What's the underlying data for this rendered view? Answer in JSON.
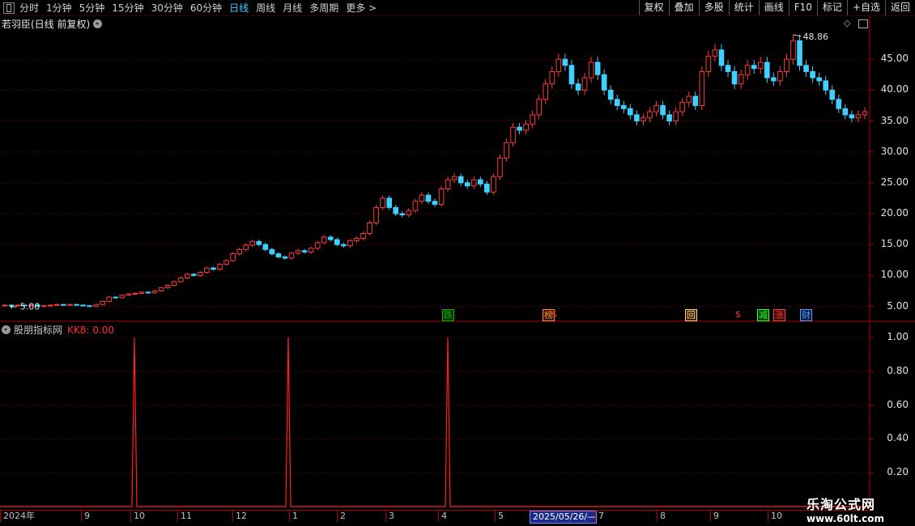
{
  "toolbar": {
    "periods": [
      "分时",
      "1分钟",
      "5分钟",
      "15分钟",
      "30分钟",
      "60分钟",
      "日线",
      "周线",
      "月线",
      "多周期",
      "更多 >"
    ],
    "active_period": "日线",
    "right_buttons": [
      "复权",
      "叠加",
      "多股",
      "统计",
      "画线",
      "F10",
      "标记",
      "+自选",
      "返回"
    ]
  },
  "main_chart": {
    "title": "若羽臣(日线 前复权)",
    "y_ticks": [
      "45.00",
      "40.00",
      "35.00",
      "30.00",
      "25.00",
      "20.00",
      "15.00",
      "10.00",
      "5.00"
    ],
    "high_label": "48.86",
    "low_label": "5.00",
    "tags": [
      {
        "text": "跌",
        "color": "#10b010",
        "bg": "#003300"
      },
      {
        "text": "榜",
        "color": "#ff8a3a",
        "bg": "#331a00"
      },
      {
        "text": "$",
        "color": "#ff3030",
        "bg": "transparent"
      },
      {
        "text": "回",
        "color": "#ffd080",
        "bg": "#332200"
      },
      {
        "text": "$",
        "color": "#ff3030",
        "bg": "transparent"
      },
      {
        "text": "减",
        "color": "#30ff30",
        "bg": "#004400"
      },
      {
        "text": "涨",
        "color": "#ff4040",
        "bg": "#330000"
      },
      {
        "text": "财",
        "color": "#60a0ff",
        "bg": "#001a44"
      }
    ]
  },
  "indicator": {
    "title": "股朋指标网",
    "series_label": "KK8: 0.00",
    "y_ticks": [
      "1.00",
      "0.80",
      "0.60",
      "0.40",
      "0.20"
    ]
  },
  "date_axis": [
    "2024年",
    "9",
    "10",
    "11",
    "12",
    "1",
    "2",
    "3",
    "4",
    "5",
    "2025/05/26/—",
    "7",
    "8",
    "9",
    "10"
  ],
  "watermark": {
    "line1": "乐淘公式网",
    "line2": "www.60lt.com"
  },
  "colors": {
    "up": "#ff3a3a",
    "down": "#3fd0ff",
    "grid": "#8a0000",
    "axis": "#b00000"
  },
  "chart_data": {
    "type": "candlestick",
    "title": "若羽臣(日线 前复权)",
    "ylim": [
      3.5,
      50
    ],
    "close_series": [
      5.2,
      5.1,
      5.2,
      5.1,
      5.2,
      5.0,
      5.1,
      5.2,
      5.3,
      5.2,
      5.3,
      5.2,
      5.1,
      5.0,
      5.3,
      5.8,
      6.5,
      6.4,
      6.8,
      7.0,
      7.1,
      7.3,
      7.2,
      7.5,
      8.0,
      8.4,
      9.0,
      9.6,
      10.2,
      10.0,
      10.5,
      11.2,
      11.0,
      11.8,
      12.4,
      13.5,
      14.2,
      14.9,
      15.5,
      15.0,
      14.2,
      13.5,
      13.0,
      12.8,
      13.6,
      14.0,
      13.8,
      14.4,
      15.3,
      16.2,
      15.8,
      15.0,
      14.8,
      15.6,
      16.0,
      16.8,
      18.5,
      21.0,
      22.5,
      21.0,
      20.0,
      19.8,
      20.5,
      22.0,
      23.0,
      22.0,
      21.5,
      24.0,
      25.5,
      26.0,
      25.0,
      24.5,
      25.5,
      24.8,
      23.5,
      26.0,
      29.0,
      31.5,
      34.0,
      33.5,
      34.5,
      36.0,
      38.5,
      41.0,
      43.0,
      45.0,
      44.0,
      41.0,
      40.0,
      42.0,
      44.5,
      42.5,
      40.0,
      38.5,
      37.5,
      37.0,
      36.0,
      35.0,
      35.5,
      36.5,
      37.5,
      36.0,
      35.0,
      36.5,
      38.0,
      39.0,
      37.5,
      43.0,
      45.5,
      46.5,
      44.0,
      43.0,
      41.0,
      42.5,
      44.0,
      43.5,
      44.5,
      42.0,
      41.5,
      43.0,
      45.0,
      48.0,
      44.0,
      43.0,
      42.0,
      41.5,
      40.0,
      38.5,
      37.0,
      36.0,
      35.5,
      36.0,
      36.5
    ]
  }
}
